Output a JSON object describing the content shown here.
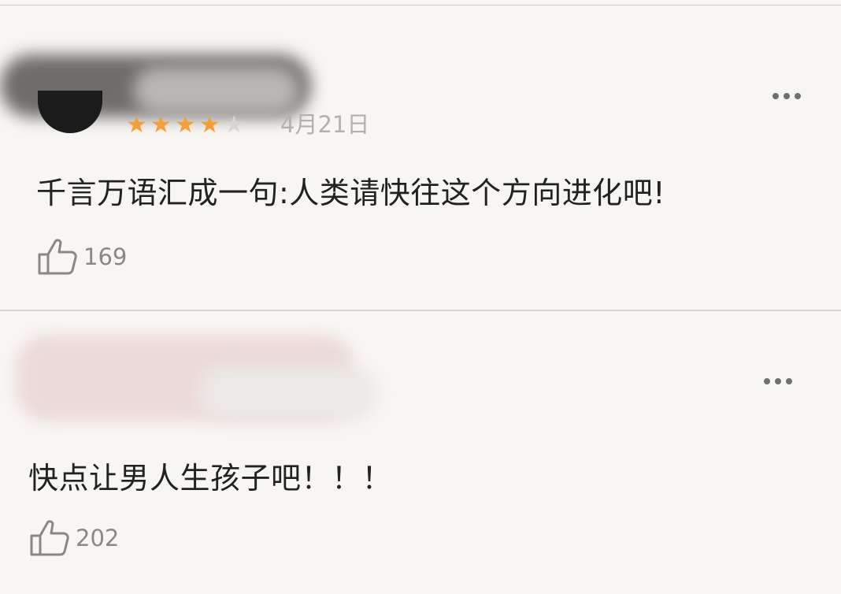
{
  "comments": [
    {
      "rating": 4,
      "max_rating": 5,
      "date": "4月21日",
      "text": "千言万语汇成一句:人类请快往这个方向进化吧!",
      "likes": "169"
    },
    {
      "date": "",
      "text": "快点让男人生孩子吧！！！",
      "likes": "202"
    }
  ],
  "icons": {
    "more": "more-dots-icon",
    "like": "thumbs-up-icon",
    "star": "star-icon"
  },
  "colors": {
    "star_active": "#f3a03b",
    "star_inactive": "#d8d5d2",
    "muted_text": "#8a8785",
    "background": "#f8f6f3"
  }
}
